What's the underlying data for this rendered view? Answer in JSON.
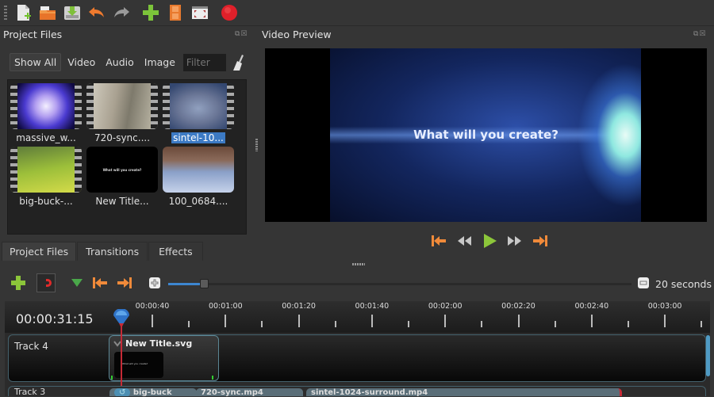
{
  "toolbar": {
    "buttons": [
      {
        "name": "new-project-icon",
        "label": "New Project"
      },
      {
        "name": "open-project-icon",
        "label": "Open Project"
      },
      {
        "name": "save-project-icon",
        "label": "Save Project"
      },
      {
        "name": "undo-icon",
        "label": "Undo"
      },
      {
        "name": "redo-icon",
        "label": "Redo"
      },
      {
        "name": "import-files-icon",
        "label": "Import Files"
      },
      {
        "name": "choose-profile-icon",
        "label": "Choose Profile"
      },
      {
        "name": "fullscreen-icon",
        "label": "Fullscreen"
      },
      {
        "name": "export-video-icon",
        "label": "Export Video"
      }
    ]
  },
  "project_files": {
    "title": "Project Files",
    "filters": {
      "show_all": "Show All",
      "video": "Video",
      "audio": "Audio",
      "image": "Image"
    },
    "filter_placeholder": "Filter",
    "files": [
      {
        "name": "massive_w...",
        "selected": false
      },
      {
        "name": "720-sync....",
        "selected": false
      },
      {
        "name": "sintel-10...",
        "selected": true
      },
      {
        "name": "big-buck-...",
        "selected": false
      },
      {
        "name": "New Title...",
        "selected": false,
        "thumb_text": "What will you create?"
      },
      {
        "name": "100_0684....",
        "selected": false
      }
    ]
  },
  "bottom_tabs": [
    {
      "label": "Project Files",
      "active": true
    },
    {
      "label": "Transitions",
      "active": false
    },
    {
      "label": "Effects",
      "active": false
    }
  ],
  "video_preview": {
    "title": "Video Preview",
    "frame_text": "What will you create?"
  },
  "transport": [
    "jump-to-start",
    "rewind",
    "play",
    "fast-forward",
    "jump-to-end"
  ],
  "timeline_toolbar": {
    "zoom_value": 0.1,
    "zoom_label": "20 seconds"
  },
  "timeline": {
    "current_time": "00:00:31:15",
    "ruler_labels": [
      "00:00:40",
      "00:01:00",
      "00:01:20",
      "00:01:40",
      "00:02:00",
      "00:02:20",
      "00:02:40",
      "00:03:00"
    ],
    "tracks": [
      {
        "label": "Track 4",
        "clips": [
          {
            "title": "New Title.svg",
            "thumb_text": "What will you create?"
          }
        ]
      },
      {
        "label": "Track 3",
        "clips": [
          {
            "title": "big-buck"
          },
          {
            "title": "720-sync.mp4"
          },
          {
            "title": "sintel-1024-surround.mp4"
          }
        ]
      }
    ]
  },
  "colors": {
    "accent": "#3d86d0",
    "selection": "#3c7ac4",
    "playhead": "#c62a36",
    "clip_border": "#5b8694"
  }
}
